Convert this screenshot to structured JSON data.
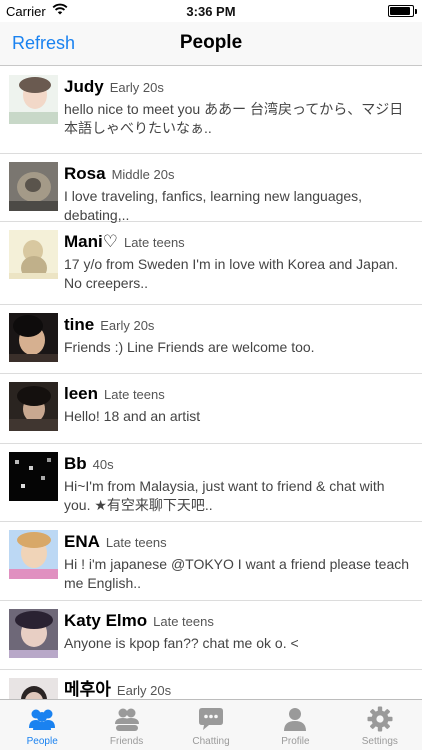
{
  "status_bar": {
    "carrier": "Carrier",
    "time": "3:36 PM",
    "battery_level": 0.9
  },
  "nav": {
    "refresh_label": "Refresh",
    "title": "People"
  },
  "people": [
    {
      "name": "Judy",
      "age": "Early 20s",
      "message": "hello nice to meet you ああー 台湾戻ってから、マジ日本語しゃべりたいなぁ.."
    },
    {
      "name": "Rosa",
      "age": "Middle 20s",
      "message": "I love traveling, fanfics, learning new languages, debating,.."
    },
    {
      "name": "Mani♡",
      "age": "Late teens",
      "message": "17 y/o from Sweden I'm in love with Korea and Japan. No creepers.."
    },
    {
      "name": "tine",
      "age": "Early 20s",
      "message": "Friends :) Line Friends are welcome too."
    },
    {
      "name": "leen",
      "age": "Late teens",
      "message": "Hello! 18 and an artist"
    },
    {
      "name": "Bb",
      "age": "40s",
      "message": "Hi~I'm from Malaysia, just want to friend & chat with you. ★有空来聊下天吧.."
    },
    {
      "name": "ENA",
      "age": "Late teens",
      "message": "Hi ! i'm japanese @TOKYO I want a friend please teach me English.."
    },
    {
      "name": "Katy Elmo",
      "age": "Late teens",
      "message": "Anyone is kpop fan?? chat me ok o. <"
    },
    {
      "name": "메후아",
      "age": "Early 20s",
      "message": ""
    }
  ],
  "tabs": [
    {
      "label": "People",
      "icon": "people-icon",
      "active": true
    },
    {
      "label": "Friends",
      "icon": "friends-icon",
      "active": false
    },
    {
      "label": "Chatting",
      "icon": "chat-bubble-icon",
      "active": false
    },
    {
      "label": "Profile",
      "icon": "profile-icon",
      "active": false
    },
    {
      "label": "Settings",
      "icon": "gear-icon",
      "active": false
    }
  ],
  "colors": {
    "accent": "#1a82f0",
    "inactive_tab": "#9a9a9a",
    "separator": "#dcdcdc"
  }
}
